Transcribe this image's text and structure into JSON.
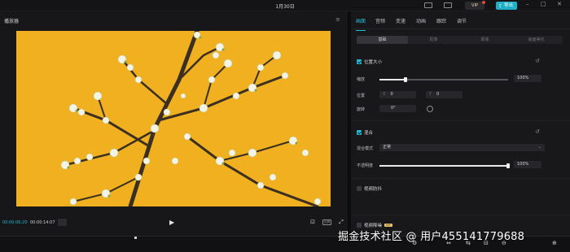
{
  "window": {
    "title": "1月30日",
    "vip_label": "VIP",
    "export_label": "导出",
    "minimize": "–",
    "maximize": "□",
    "close": "✕"
  },
  "player": {
    "title": "播放器",
    "current_time": "00:00:06:20",
    "total_time": "00:00:14:07",
    "ratio_label": "比例"
  },
  "inspector": {
    "tabs": [
      {
        "label": "画面",
        "active": true
      },
      {
        "label": "音频",
        "active": false
      },
      {
        "label": "变速",
        "active": false
      },
      {
        "label": "动画",
        "active": false
      },
      {
        "label": "跟踪",
        "active": false
      },
      {
        "label": "调节",
        "active": false
      }
    ],
    "subtabs": [
      {
        "label": "基础",
        "active": true
      },
      {
        "label": "抠像",
        "active": false
      },
      {
        "label": "蒙版",
        "active": false
      },
      {
        "label": "画面美化",
        "active": false
      }
    ],
    "position_size": {
      "heading": "位置大小",
      "enabled": true,
      "scale_label": "缩放",
      "scale_value": "100%",
      "scale_fraction": 0.2,
      "position_label": "位置",
      "x_key": "X",
      "x_value": "0",
      "y_key": "Y",
      "y_value": "0",
      "rotate_label": "旋转",
      "rotate_value": "0°"
    },
    "blend": {
      "heading": "混合",
      "enabled": true,
      "mode_label": "混合模式",
      "mode_value": "正常",
      "opacity_label": "不透明度",
      "opacity_value": "100%",
      "opacity_fraction": 1.0
    },
    "stabilize": {
      "heading": "视频防抖",
      "enabled": false
    },
    "denoise": {
      "heading": "视频降噪",
      "vip_tag": "VIP",
      "enabled": false
    }
  },
  "watermark": "掘金技术社区 @ 用户455141779688",
  "colors": {
    "accent": "#22c0d8",
    "video_background": "#f0b020"
  }
}
